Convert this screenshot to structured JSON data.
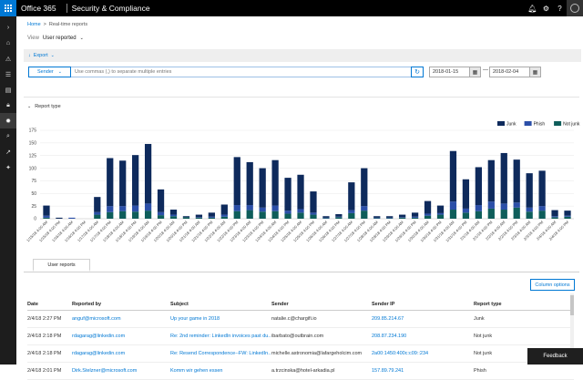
{
  "topbar": {
    "brand": "Office 365",
    "app_name": "Security & Compliance",
    "icons": [
      "bell-icon",
      "gear-icon",
      "help-icon",
      "avatar"
    ]
  },
  "nav_icons": [
    "chevron-right-icon",
    "home-icon",
    "alerts-icon",
    "permissions-icon",
    "classifications-icon",
    "data-loss-icon",
    "threat-management-icon",
    "search-icon",
    "reports-icon",
    "service-assurance-icon"
  ],
  "breadcrumb": {
    "home": "Home",
    "separator": ">",
    "current": "Real-time reports"
  },
  "view": {
    "label": "View",
    "value": "User reported"
  },
  "toolbar": {
    "export_label": "Export"
  },
  "filter": {
    "sender_label": "Sender",
    "input_placeholder": "Use commas (,) to separate multiple entries",
    "date_from": "2018-01-15",
    "date_dash": "—",
    "date_to": "2018-02-04"
  },
  "report_type_label": "Report type",
  "chart_data": {
    "type": "bar",
    "stacked": true,
    "ylim": [
      0,
      175
    ],
    "yticks": [
      0,
      25,
      50,
      75,
      100,
      125,
      150,
      175
    ],
    "grid": true,
    "legend_position": "top-right",
    "categories": [
      "1/15/18 4:00 AM",
      "1/15/18 4:00 PM",
      "1/16/18 4:00 AM",
      "1/16/18 4:00 PM",
      "1/17/18 4:00 AM",
      "1/17/18 4:00 PM",
      "1/18/18 4:00 AM",
      "1/18/18 4:00 PM",
      "1/19/18 4:00 AM",
      "1/19/18 4:00 PM",
      "1/20/18 4:00 AM",
      "1/20/18 4:00 PM",
      "1/21/18 4:00 AM",
      "1/21/18 4:00 PM",
      "1/22/18 4:00 AM",
      "1/22/18 4:00 PM",
      "1/23/18 4:00 AM",
      "1/23/18 4:00 PM",
      "1/24/18 4:00 AM",
      "1/24/18 4:00 PM",
      "1/25/18 4:00 AM",
      "1/25/18 4:00 PM",
      "1/26/18 4:00 AM",
      "1/26/18 4:00 PM",
      "1/27/18 4:00 AM",
      "1/27/18 4:00 PM",
      "1/28/18 4:00 AM",
      "1/28/18 4:00 PM",
      "1/29/18 4:00 AM",
      "1/29/18 4:00 PM",
      "1/30/18 4:00 AM",
      "1/30/18 4:00 PM",
      "1/31/18 4:00 AM",
      "1/31/18 4:00 PM",
      "2/1/18 4:00 AM",
      "2/1/18 4:00 PM",
      "2/2/18 4:00 AM",
      "2/2/18 4:00 PM",
      "2/3/18 4:00 AM",
      "2/3/18 4:00 PM",
      "2/4/18 4:00 AM",
      "2/4/18 4:00 PM"
    ],
    "series": [
      {
        "name": "Junk",
        "color": "#0e2a5c",
        "values": [
          20,
          2,
          0,
          0,
          30,
          95,
          90,
          100,
          118,
          45,
          10,
          2,
          5,
          8,
          20,
          95,
          85,
          78,
          90,
          65,
          68,
          42,
          3,
          5,
          55,
          75,
          3,
          3,
          5,
          8,
          25,
          15,
          100,
          58,
          75,
          82,
          100,
          85,
          68,
          70,
          12,
          10
        ]
      },
      {
        "name": "Phish",
        "color": "#2b4fa8",
        "values": [
          4,
          0,
          2,
          0,
          5,
          12,
          10,
          12,
          14,
          6,
          3,
          0,
          1,
          2,
          4,
          12,
          10,
          8,
          11,
          6,
          7,
          4,
          1,
          1,
          6,
          9,
          1,
          1,
          1,
          2,
          4,
          3,
          16,
          8,
          12,
          14,
          12,
          10,
          8,
          9,
          2,
          2
        ]
      },
      {
        "name": "Not junk",
        "color": "#0e5d5a",
        "values": [
          2,
          0,
          0,
          0,
          8,
          13,
          15,
          14,
          16,
          7,
          5,
          3,
          2,
          2,
          4,
          15,
          17,
          14,
          15,
          10,
          12,
          8,
          1,
          3,
          11,
          16,
          1,
          1,
          2,
          2,
          6,
          8,
          18,
          12,
          15,
          20,
          18,
          22,
          14,
          16,
          3,
          4
        ]
      }
    ]
  },
  "tabs": [
    {
      "label": "User reports"
    }
  ],
  "column_options_label": "Column options",
  "table": {
    "headers": [
      "Date",
      "Reported by",
      "Subject",
      "Sender",
      "Sender IP",
      "Report type"
    ],
    "rows": [
      [
        "2/4/18 2:27 PM",
        "anguf@microsoft.com",
        "Up your game in 2018",
        "natalie.c@chargifi.io",
        "209.85.214.67",
        "Junk"
      ],
      [
        "2/4/18 2:18 PM",
        "rdagarag@linkedin.com",
        "Re: 2nd reminder: LinkedIn invoices past du...",
        "ibarbato@outbrain.com",
        "208.87.234.190",
        "Not junk"
      ],
      [
        "2/4/18 2:18 PM",
        "rdagarag@linkedin.com",
        "Re: Resend Correspondence--FW: LinkedIn...",
        "michelle.astronomia@lafargeholcim.com",
        "2a00:1450:400c:c09::234",
        "Not junk"
      ],
      [
        "2/4/18 2:01 PM",
        "Dirk.Stelzner@microsoft.com",
        "Komm wir gehen essen",
        "a.trzcinska@hotel-arkadia.pl",
        "157.89.79.241",
        "Phish"
      ]
    ]
  },
  "feedback_label": "Feedback"
}
